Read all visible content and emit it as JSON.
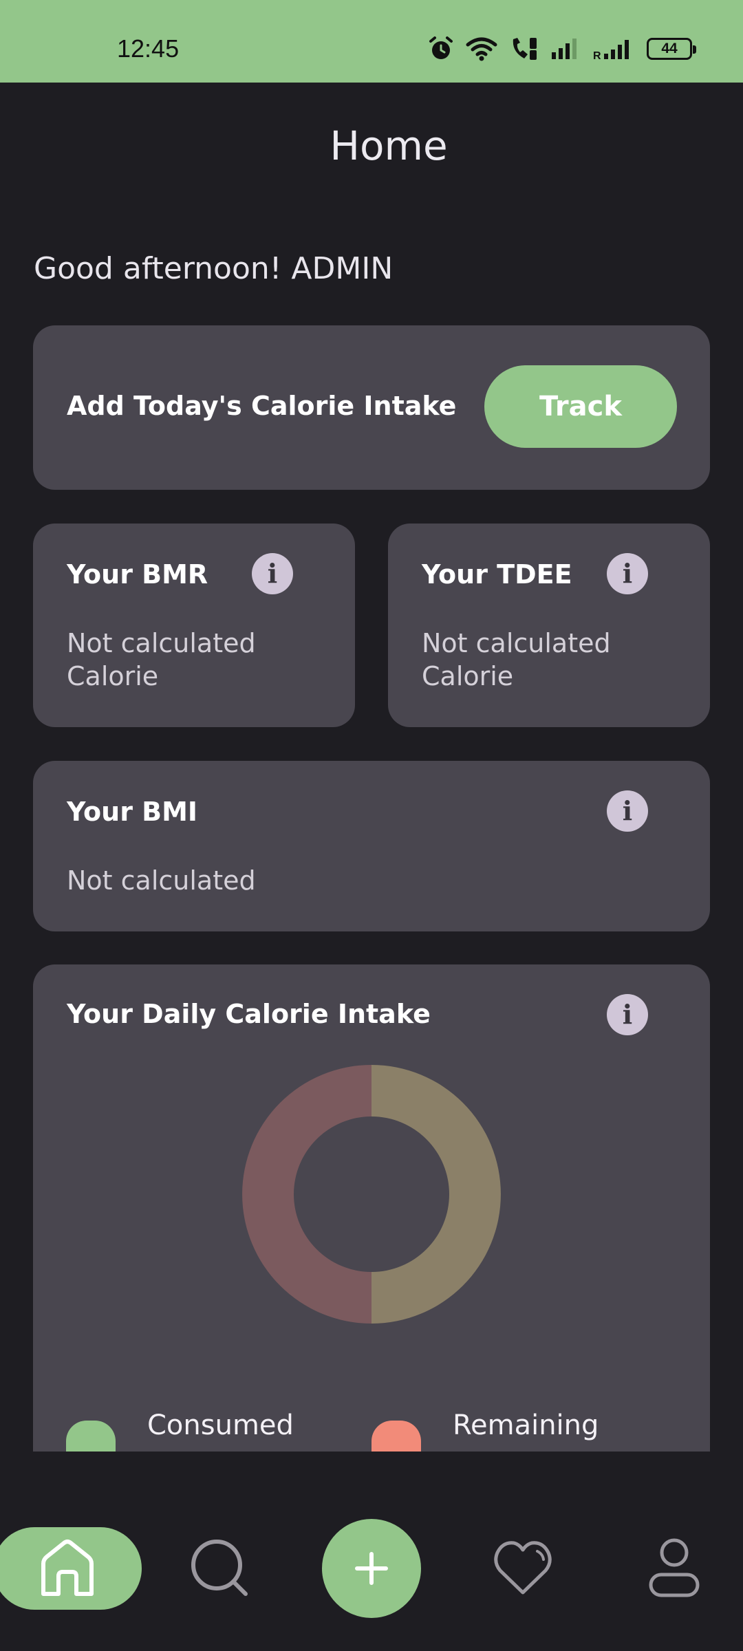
{
  "status_bar": {
    "time": "12:45",
    "battery": "44",
    "icons": [
      "alarm-icon",
      "wifi-icon",
      "volte-call-icon",
      "signal-icon",
      "roaming-signal-icon",
      "battery-icon"
    ]
  },
  "header": {
    "title": "Home"
  },
  "greeting": "Good afternoon! ADMIN",
  "track_card": {
    "label": "Add Today's Calorie Intake",
    "button_label": "Track"
  },
  "bmr_card": {
    "title": "Your BMR",
    "value_line1": "Not calculated",
    "value_line2": "Calorie",
    "info_icon": "i"
  },
  "tdee_card": {
    "title": "Your TDEE",
    "value_line1": "Not calculated",
    "value_line2": "Calorie",
    "info_icon": "i"
  },
  "bmi_card": {
    "title": "Your BMI",
    "value": "Not calculated",
    "info_icon": "i"
  },
  "calorie_card": {
    "title": "Your Daily Calorie Intake",
    "info_icon": "i",
    "legend": [
      {
        "label": "Consumed",
        "color": "#93c68a"
      },
      {
        "label": "Remaining",
        "color": "#f28b79"
      }
    ]
  },
  "chart_data": {
    "type": "pie",
    "style": "donut",
    "title": "Your Daily Calorie Intake",
    "slices": [
      {
        "label": "Consumed",
        "value": 50,
        "color": "#8b8068"
      },
      {
        "label": "Remaining",
        "value": 50,
        "color": "#7b5a5e"
      }
    ]
  },
  "bottom_nav": {
    "items": [
      "home-icon",
      "search-icon",
      "add-icon",
      "favorites-icon",
      "profile-icon"
    ],
    "active": "home-icon",
    "accent": "#93c68a"
  }
}
